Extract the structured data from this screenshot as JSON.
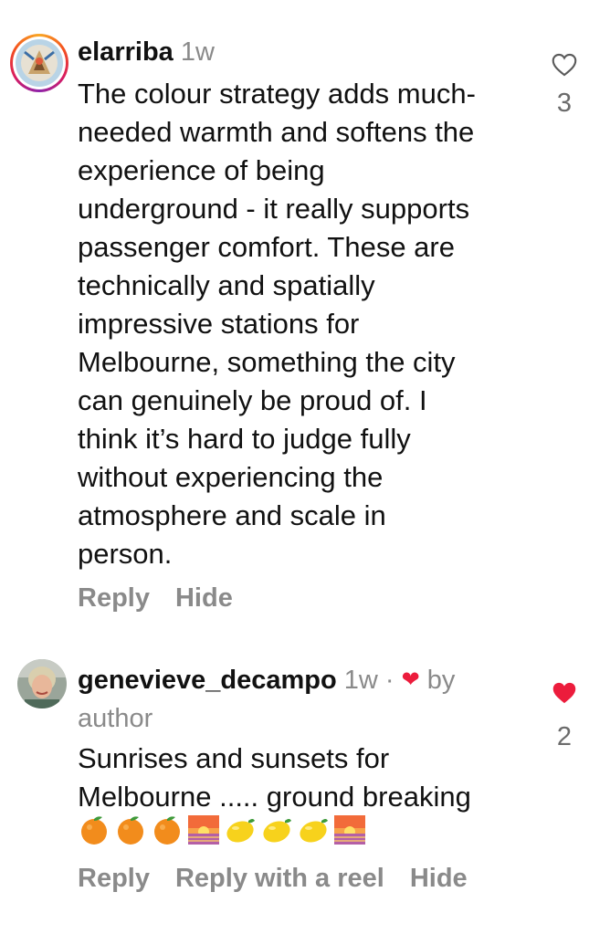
{
  "comments": [
    {
      "username": "elarriba",
      "time": "1w",
      "text": "The colour strategy adds much-\nneeded warmth and softens the\nexperience of being\nunderground - it really supports\npassenger comfort. These are\ntechnically and spatially\nimpressive stations for\nMelbourne, something the city\ncan genuinely be proud of. I\nthink it’s hard to judge fully\nwithout experiencing the\natmosphere and scale in\nperson.",
      "likes": "3",
      "liked": false,
      "actions": {
        "reply": "Reply",
        "hide": "Hide"
      }
    },
    {
      "username": "genevieve_decampo",
      "time": "1w ·",
      "by_author_label": "by",
      "by_author_label2": "author",
      "text": "Sunrises and sunsets for\nMelbourne ..... ground breaking",
      "emojis": [
        "orange-emoji",
        "orange-emoji",
        "orange-emoji",
        "sunrise-emoji",
        "lemon-emoji",
        "lemon-emoji",
        "lemon-emoji",
        "sunrise-emoji"
      ],
      "likes": "2",
      "liked": true,
      "actions": {
        "reply": "Reply",
        "reply_reel": "Reply with a reel",
        "hide": "Hide"
      }
    }
  ],
  "colors": {
    "like_red": "#ec1c3c",
    "muted": "#8a8a8a"
  }
}
